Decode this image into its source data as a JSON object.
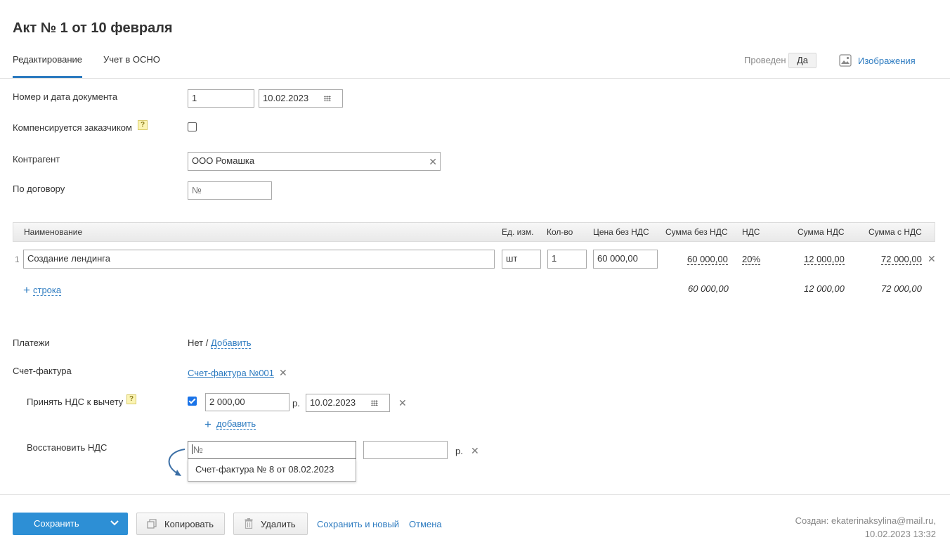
{
  "header": {
    "title": "Акт № 1 от 10 февраля",
    "tabs": [
      {
        "label": "Редактирование",
        "active": true
      },
      {
        "label": "Учет в ОСНО",
        "active": false
      }
    ],
    "posted_label": "Проведен",
    "posted_value": "Да",
    "images_label": "Изображения"
  },
  "form": {
    "doc_number_label": "Номер и дата документа",
    "doc_number": "1",
    "doc_date": "10.02.2023",
    "compensated_label": "Компенсируется заказчиком",
    "help_mark": "?",
    "compensated_checked": false,
    "counterparty_label": "Контрагент",
    "counterparty": "ООО Ромашка",
    "contract_label": "По договору",
    "contract_placeholder": "№"
  },
  "table": {
    "columns": [
      "Наименование",
      "Ед. изм.",
      "Кол-во",
      "Цена без НДС",
      "Сумма без НДС",
      "НДС",
      "Сумма НДС",
      "Сумма с НДС"
    ],
    "rows": [
      {
        "index": "1",
        "name": "Создание лендинга",
        "unit": "шт",
        "qty": "1",
        "price": "60 000,00",
        "sum_no_vat": "60 000,00",
        "vat_rate": "20%",
        "vat_sum": "12 000,00",
        "total": "72 000,00"
      }
    ],
    "add_row_label": "строка",
    "totals": {
      "sum_no_vat": "60 000,00",
      "vat_sum": "12 000,00",
      "total": "72 000,00"
    }
  },
  "payments": {
    "label": "Платежи",
    "value": "Нет",
    "separator": "/",
    "add_label": "Добавить"
  },
  "invoice": {
    "label": "Счет-фактура",
    "link": "Счет-фактура №001"
  },
  "vat_deduction": {
    "label": "Принять НДС к вычету",
    "checked": true,
    "amount": "2 000,00",
    "currency": "р.",
    "date": "10.02.2023",
    "add_label": "добавить"
  },
  "vat_restore": {
    "label": "Восстановить НДС",
    "invoice_placeholder": "№",
    "amount": "",
    "currency": "р.",
    "suggestion": "Счет-фактура № 8 от 08.02.2023"
  },
  "footer": {
    "save_label": "Сохранить",
    "copy_label": "Копировать",
    "delete_label": "Удалить",
    "save_new_label": "Сохранить и новый",
    "cancel_label": "Отмена",
    "created_line1": "Создан: ekaterinaksylina@mail.ru,",
    "created_line2": "10.02.2023 13:32"
  },
  "colors": {
    "accent": "#2d7bc0",
    "save_button": "#2d8fd5",
    "checkbox": "#1a73e8"
  },
  "icons": [
    "calendar-icon",
    "clear-icon",
    "help-icon",
    "image-icon",
    "plus-icon",
    "close-icon",
    "chevron-down-icon",
    "copy-icon",
    "trash-icon",
    "curved-arrow-icon"
  ]
}
